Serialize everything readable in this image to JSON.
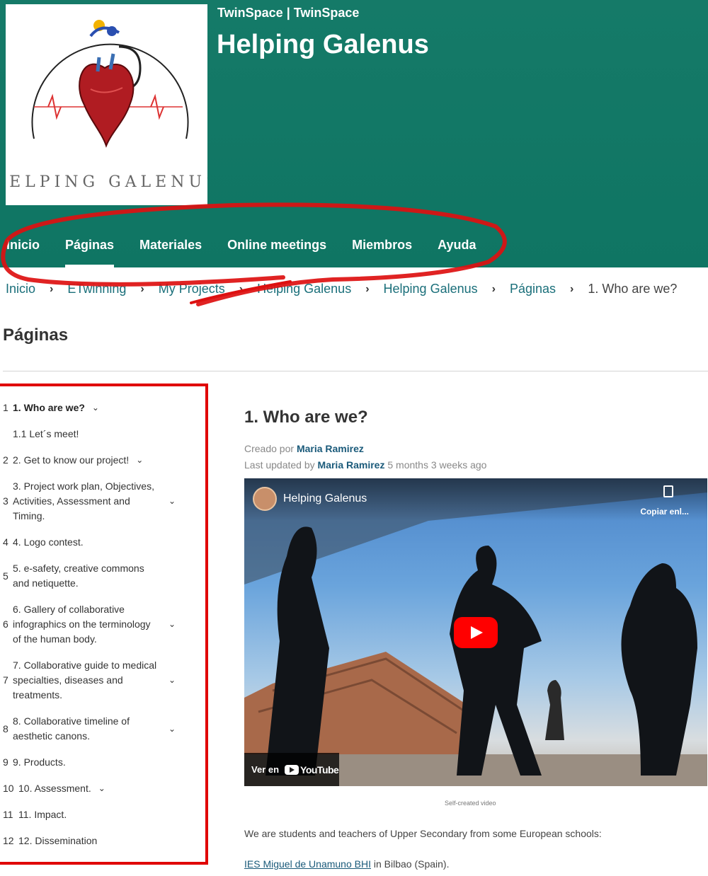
{
  "header": {
    "subtitle": "TwinSpace | TwinSpace",
    "title": "Helping Galenus",
    "logo_text": "HELPING GALENUS"
  },
  "nav": {
    "items": [
      {
        "label": "Inicio"
      },
      {
        "label": "Páginas",
        "active": true
      },
      {
        "label": "Materiales"
      },
      {
        "label": "Online meetings"
      },
      {
        "label": "Miembros"
      },
      {
        "label": "Ayuda"
      }
    ]
  },
  "breadcrumb": [
    "Inicio",
    "ETwinning",
    "My Projects",
    "Helping Galenus",
    "Helping Galenus",
    "Páginas",
    "1. Who are we?"
  ],
  "page_heading": "Páginas",
  "toc": [
    {
      "num": "1",
      "text": "1. Who are we?",
      "expandable": true,
      "bold": true
    },
    {
      "num": "",
      "text": "1.1  Let´s meet!",
      "sub": true
    },
    {
      "num": "2",
      "text": "2. Get to know our project!",
      "expandable": true
    },
    {
      "num": "3",
      "text": "3. Project work plan, Objectives, Activities, Assessment and Timing.",
      "expandable": true
    },
    {
      "num": "4",
      "text": "4. Logo contest."
    },
    {
      "num": "5",
      "text": "5. e-safety, creative commons and netiquette."
    },
    {
      "num": "6",
      "text": "6. Gallery of collaborative infographics on the terminology of the human body.",
      "expandable": true
    },
    {
      "num": "7",
      "text": "7. Collaborative guide to medical specialties, diseases and treatments.",
      "expandable": true
    },
    {
      "num": "8",
      "text": "8. Collaborative timeline of aesthetic canons.",
      "expandable": true
    },
    {
      "num": "9",
      "text": "9. Products."
    },
    {
      "num": "10",
      "text": "10. Assessment.",
      "expandable": true
    },
    {
      "num": "11",
      "text": "11. Impact."
    },
    {
      "num": "12",
      "text": "12. Dissemination"
    }
  ],
  "content": {
    "title": "1. Who are we?",
    "created_prefix": "Creado por",
    "created_by": "Maria Ramirez",
    "updated_prefix": "Last updated by",
    "updated_by": "Maria Ramirez",
    "updated_ago": "5 months 3 weeks ago",
    "video": {
      "title": "Helping Galenus",
      "copy_label": "Copiar enl...",
      "watch_on": "Ver en",
      "youtube": "YouTube"
    },
    "caption": "Self-created video",
    "paragraph": "We are students and teachers of Upper Secondary from some European schools:",
    "school_link": "IES Miguel de Unamuno BHI",
    "school_suffix": " in Bilbao (Spain)."
  },
  "colors": {
    "header_bg": "#157a68",
    "annotation": "#e00000",
    "link": "#1a6f7a"
  }
}
